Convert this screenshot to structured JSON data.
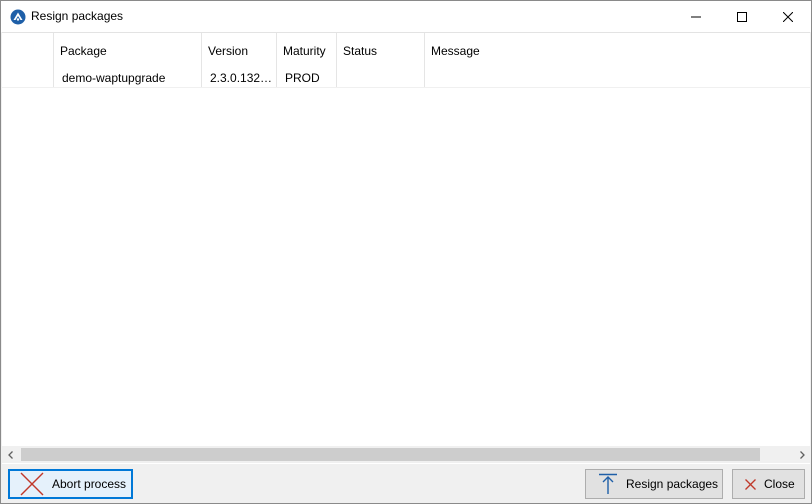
{
  "window": {
    "title": "Resign packages",
    "app_icon": "wapt-logo-icon"
  },
  "caption_buttons": {
    "minimize": "minimize-icon",
    "maximize": "maximize-icon",
    "close": "close-icon"
  },
  "grid": {
    "columns": [
      "Package",
      "Version",
      "Maturity",
      "Status",
      "Message"
    ],
    "rows": [
      {
        "package": "demo-waptupgrade",
        "version": "2.3.0.1320...",
        "maturity": "PROD",
        "status": "",
        "message": ""
      }
    ]
  },
  "scrollbar": {
    "left_arrow": "chevron-left-icon",
    "right_arrow": "chevron-right-icon"
  },
  "buttons": {
    "abort_label": "Abort process",
    "abort_icon": "cross-icon",
    "resign_label": "Resign packages",
    "resign_icon": "arrow-up-icon",
    "close_label": "Close",
    "close_icon": "close-icon"
  },
  "colors": {
    "accent": "#0078d7",
    "abort_icon": "#c0392b",
    "resign_icon": "#1e5fa8"
  }
}
